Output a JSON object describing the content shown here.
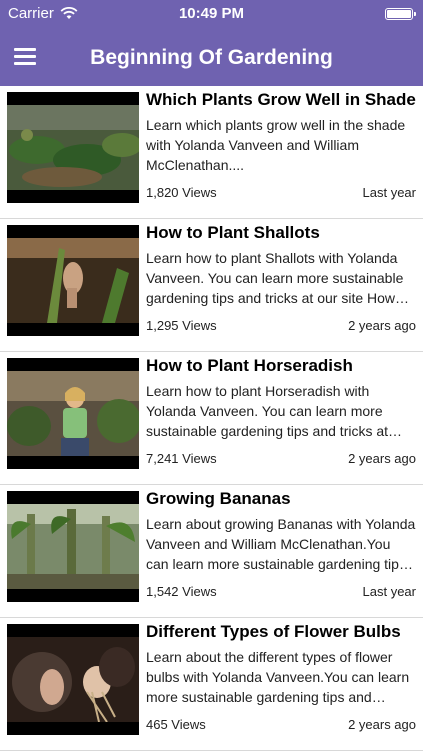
{
  "status_bar": {
    "carrier": "Carrier",
    "time": "10:49 PM",
    "wifi_icon": "wifi-icon",
    "battery_icon": "battery-icon"
  },
  "header": {
    "title": "Beginning Of Gardening",
    "menu_icon": "hamburger-menu-icon"
  },
  "colors": {
    "header_bg": "#6f62b0",
    "separator": "#d8d8d8"
  },
  "videos": [
    {
      "title": "Which Plants Grow Well in Shade",
      "description": "Learn which plants grow well in the shade with Yolanda Vanveen and William McClenathan....",
      "views": "1,820 Views",
      "age": "Last year"
    },
    {
      "title": "How to Plant Shallots",
      "description": "Learn how to plant Shallots with Yolanda Vanveen. You can learn more sustainable gardening tips and tricks at our site How to...",
      "views": "1,295 Views",
      "age": "2 years ago"
    },
    {
      "title": "How to Plant Horseradish",
      "description": "Learn how to plant Horseradish with Yolanda Vanveen. You can learn more sustainable gardening tips and tricks at our...",
      "views": "7,241 Views",
      "age": "2 years ago"
    },
    {
      "title": "Growing Bananas",
      "description": "Learn about growing Bananas with Yolanda Vanveen and William McClenathan.You can learn more sustainable gardening tips and...",
      "views": "1,542 Views",
      "age": "Last year"
    },
    {
      "title": "Different Types of Flower Bulbs",
      "description": "Learn about the different types of flower bulbs with Yolanda Vanveen.You can learn more sustainable gardening tips and tricks...",
      "views": "465 Views",
      "age": "2 years ago"
    }
  ]
}
